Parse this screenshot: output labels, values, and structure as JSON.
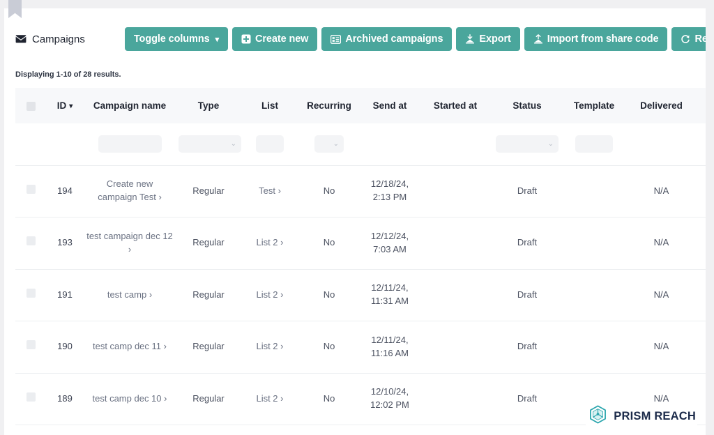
{
  "header": {
    "title": "Campaigns",
    "title_icon": "envelope-icon",
    "buttons": [
      {
        "label": "Toggle columns",
        "icon": "none",
        "caret": true,
        "name": "toggle-columns-button"
      },
      {
        "label": "Create new",
        "icon": "plus-square-icon",
        "caret": false,
        "name": "create-new-button"
      },
      {
        "label": "Archived campaigns",
        "icon": "archive-icon",
        "caret": false,
        "name": "archived-campaigns-button"
      },
      {
        "label": "Export",
        "icon": "export-icon",
        "caret": false,
        "name": "export-button"
      },
      {
        "label": "Import from share code",
        "icon": "import-icon",
        "caret": false,
        "name": "import-from-share-code-button"
      },
      {
        "label": "Refresh",
        "icon": "refresh-icon",
        "caret": false,
        "name": "refresh-button"
      }
    ]
  },
  "results": {
    "text": "Displaying 1-10 of 28 results."
  },
  "table": {
    "columns": [
      {
        "key": "check",
        "label": "",
        "sort": false
      },
      {
        "key": "id",
        "label": "ID",
        "sort": true
      },
      {
        "key": "name",
        "label": "Campaign name",
        "sort": false
      },
      {
        "key": "type",
        "label": "Type",
        "sort": false
      },
      {
        "key": "list",
        "label": "List",
        "sort": false
      },
      {
        "key": "recurring",
        "label": "Recurring",
        "sort": false
      },
      {
        "key": "send_at",
        "label": "Send at",
        "sort": false
      },
      {
        "key": "started_at",
        "label": "Started at",
        "sort": false
      },
      {
        "key": "status",
        "label": "Status",
        "sort": false
      },
      {
        "key": "template",
        "label": "Template",
        "sort": false
      },
      {
        "key": "delivered",
        "label": "Delivered",
        "sort": false
      }
    ],
    "sort_indicator": "▾",
    "filters": {
      "name_value": "",
      "name_placeholder": "",
      "type_value": "",
      "type_placeholder": "",
      "list_value": "",
      "list_placeholder": "",
      "recurring_value": "",
      "recurring_placeholder": "",
      "status_value": "",
      "status_placeholder": "",
      "template_value": "",
      "template_placeholder": "",
      "chevron": "⌄"
    },
    "rows": [
      {
        "id": "194",
        "name": "Create new campaign Test",
        "name_chevron": "›",
        "type": "Regular",
        "list": "Test",
        "list_chevron": "›",
        "recurring": "No",
        "send_at_date": "12/18/24,",
        "send_at_time": "2:13 PM",
        "started_at": "",
        "status": "Draft",
        "template": "",
        "delivered": "N/A"
      },
      {
        "id": "193",
        "name": "test campaign dec 12",
        "name_chevron": "›",
        "type": "Regular",
        "list": "List 2",
        "list_chevron": "›",
        "recurring": "No",
        "send_at_date": "12/12/24,",
        "send_at_time": "7:03 AM",
        "started_at": "",
        "status": "Draft",
        "template": "",
        "delivered": "N/A"
      },
      {
        "id": "191",
        "name": "test camp",
        "name_chevron": "›",
        "type": "Regular",
        "list": "List 2",
        "list_chevron": "›",
        "recurring": "No",
        "send_at_date": "12/11/24,",
        "send_at_time": "11:31 AM",
        "started_at": "",
        "status": "Draft",
        "template": "",
        "delivered": "N/A"
      },
      {
        "id": "190",
        "name": "test camp dec 11",
        "name_chevron": "›",
        "type": "Regular",
        "list": "List 2",
        "list_chevron": "›",
        "recurring": "No",
        "send_at_date": "12/11/24,",
        "send_at_time": "11:16 AM",
        "started_at": "",
        "status": "Draft",
        "template": "",
        "delivered": "N/A"
      },
      {
        "id": "189",
        "name": "test camp dec 10",
        "name_chevron": "›",
        "type": "Regular",
        "list": "List 2",
        "list_chevron": "›",
        "recurring": "No",
        "send_at_date": "12/10/24,",
        "send_at_time": "12:02 PM",
        "started_at": "",
        "status": "Draft",
        "template": "",
        "delivered": "N/A"
      }
    ]
  },
  "footer": {
    "logo_text": "PRISM REACH",
    "logo_icon": "prism-polyhedron-icon"
  },
  "colors": {
    "accent": "#4aa69c",
    "header_bg": "#f7f8fa",
    "page_bg": "#f0f0f2",
    "text": "#1f2430",
    "muted": "#6a7182",
    "logo_navy": "#1c2b4a",
    "logo_teal": "#2aa5ad"
  }
}
